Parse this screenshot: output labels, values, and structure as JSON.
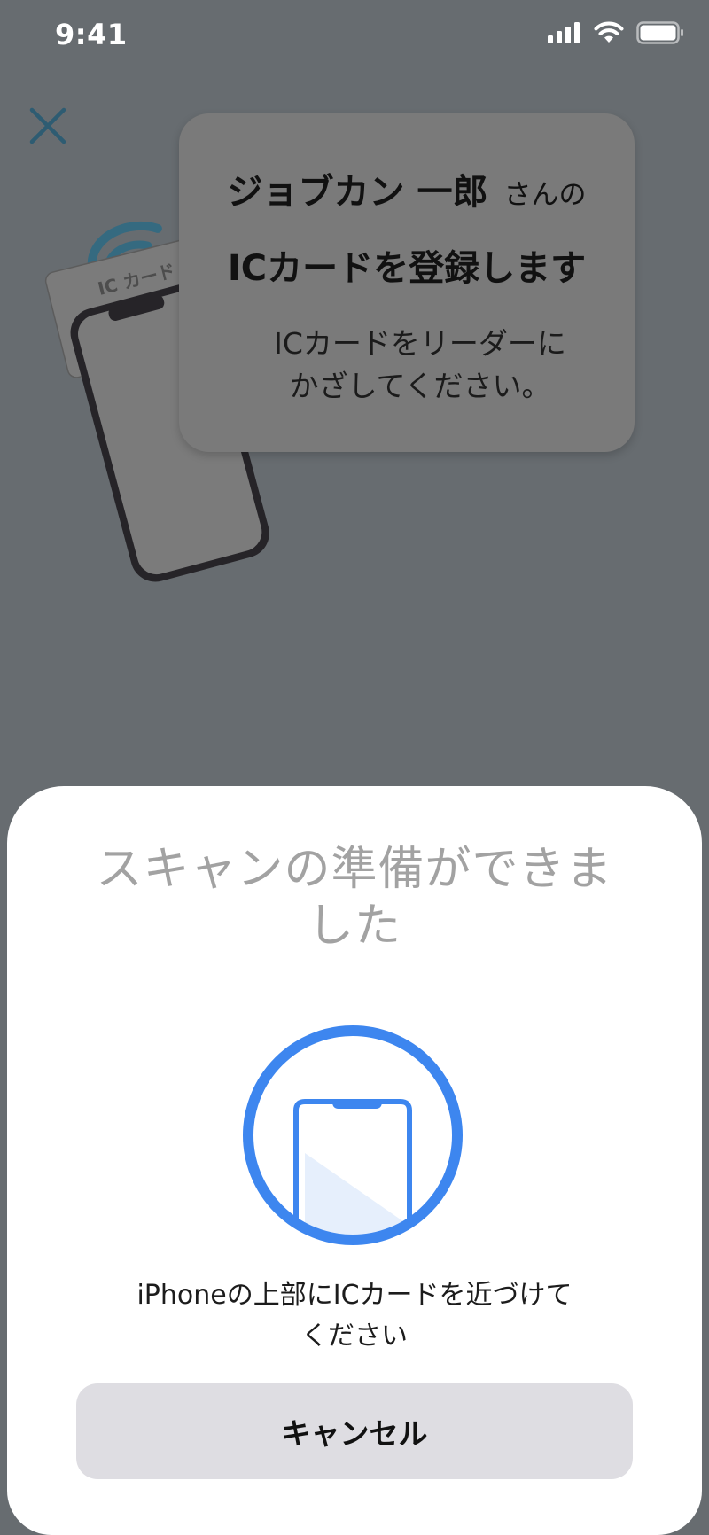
{
  "status_bar": {
    "time": "9:41",
    "icons": [
      "cellular-signal-icon",
      "wifi-icon",
      "battery-icon"
    ]
  },
  "header": {
    "close_icon": "close-icon"
  },
  "illustration": {
    "card_label": "IC カード",
    "icons": [
      "nfc-wave-icon",
      "phone-icon"
    ]
  },
  "info_card": {
    "name": "ジョブカン 一郎",
    "name_suffix": "さんの",
    "heading": "ICカードを登録します",
    "instruction_line1": "ICカードをリーダーに",
    "instruction_line2": "かざしてください。"
  },
  "scan_sheet": {
    "title_line1": "スキャンの準備ができま",
    "title_line2": "した",
    "instruction_line1": "iPhoneの上部にICカードを近づけて",
    "instruction_line2": "ください",
    "cancel_label": "キャンセル",
    "accent_color": "#3d86ef"
  }
}
